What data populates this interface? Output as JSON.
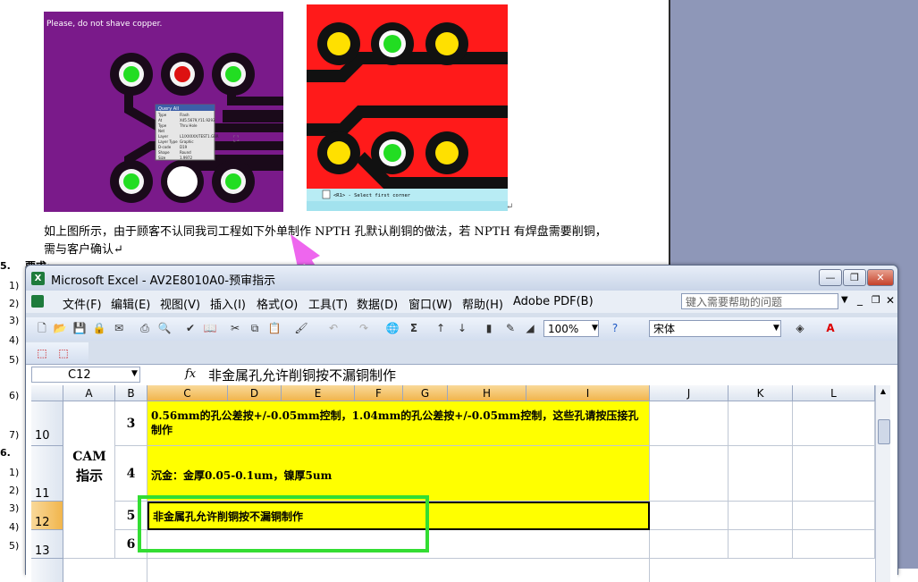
{
  "doc": {
    "pcb_left_note": "Please, do not shave copper.",
    "query_title": "Query All",
    "query_rows": [
      [
        "Type",
        "Flash"
      ],
      [
        "At",
        "X45.5679,Y11.9293"
      ],
      [
        "Type",
        "Thru Hole"
      ],
      [
        "Net",
        ""
      ],
      [
        "Layer",
        "L1/XXXXX/TEST1.GBR"
      ],
      [
        "Layer Type",
        "Graphic"
      ],
      [
        "D-code",
        "D19"
      ],
      [
        "Shape",
        "Round"
      ],
      [
        "Size",
        "1.9972"
      ]
    ],
    "status_line": "<R1> - Select first corner",
    "para_line1": "如上图所示，由于顾客不认同我司工程如下外单制作 NPTH 孔默认削铜的做法，若 NPTH 有焊盘需要削铜，",
    "para_line2": "需与客户确认↵",
    "heading_fragment": "要求:",
    "section5": "5.",
    "section6": "6.",
    "margin_numbers_top": [
      "1)",
      "2)",
      "3)",
      "4)",
      "5)",
      "6)",
      "7)"
    ],
    "margin_numbers_bottom": [
      "1)",
      "2)",
      "3)",
      "4)",
      "5)"
    ]
  },
  "excel": {
    "title": "Microsoft Excel - AV2E8010A0-预审指示",
    "app_icon": "X",
    "window_buttons": {
      "minimize": "—",
      "restore": "❐",
      "close": "✕"
    },
    "menus": [
      "文件(F)",
      "编辑(E)",
      "视图(V)",
      "插入(I)",
      "格式(O)",
      "工具(T)",
      "数据(D)",
      "窗口(W)",
      "帮助(H)",
      "Adobe PDF(B)"
    ],
    "help_placeholder": "键入需要帮助的问题",
    "zoom": "100%",
    "font": "宋体",
    "name_box": "C12",
    "fx_label": "fx",
    "formula": "非金属孔允许削铜按不漏铜制作",
    "columns": [
      "A",
      "B",
      "C",
      "D",
      "E",
      "F",
      "G",
      "H",
      "I",
      "J",
      "K",
      "L"
    ],
    "rows": [
      {
        "num": "10",
        "b": "3",
        "c": "0.56mm的孔公差按+/-0.05mm控制，1.04mm的孔公差按+/-0.05mm控制，这些孔请按压接孔制作"
      },
      {
        "num": "11",
        "b": "4",
        "c": "沉金：金厚0.05-0.1um，镍厚5um"
      },
      {
        "num": "12",
        "b": "5",
        "c": "非金属孔允许削铜按不漏铜制作"
      },
      {
        "num": "13",
        "b": "6",
        "c": ""
      }
    ],
    "merged_a_label": "CAM\n指示",
    "merged_a_line1": "CAM",
    "merged_a_line2": "指示",
    "colors": {
      "highlight": "#ffff00",
      "selection_header": "#f1b54c",
      "annotation_box": "#33dd33",
      "arrow": "#ee66ee"
    }
  }
}
